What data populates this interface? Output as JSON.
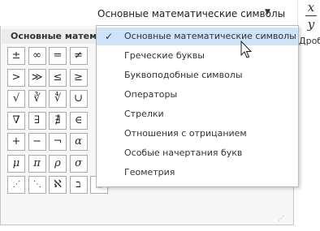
{
  "header": {
    "selected_category": "Основные математические символы",
    "dropdown_arrow": "▼"
  },
  "ribbon": {
    "fraction_top": "x",
    "fraction_bottom": "y",
    "fraction_label": "Дробь"
  },
  "gallery": {
    "title": "Основные математические символы",
    "rows": [
      [
        "±",
        "∞",
        "=",
        "≠"
      ],
      [
        ">",
        "≫",
        "≤",
        "≥"
      ],
      [
        "√",
        "∛",
        "∜",
        "∪"
      ],
      [
        "∇",
        "∃",
        "∄",
        "∈"
      ],
      [
        "+",
        "−",
        "¬",
        "α"
      ],
      [
        "μ",
        "π",
        "ρ",
        "σ"
      ],
      [
        "⋰",
        "⋱",
        "ℵ",
        "ב",
        "■"
      ]
    ],
    "grip": "⋰"
  },
  "menu": {
    "check_mark": "✓",
    "items": [
      {
        "label": "Основные математические символы",
        "selected": true
      },
      {
        "label": "Греческие буквы"
      },
      {
        "label": "Буквоподобные символы"
      },
      {
        "label": "Операторы"
      },
      {
        "label": "Стрелки"
      },
      {
        "label": "Отношения с отрицанием"
      },
      {
        "label": "Особые начертания букв"
      },
      {
        "label": "Геометрия"
      }
    ]
  },
  "colors": {
    "selected_item_bg": "#cde3f7",
    "panel_bg": "#f7f7f7"
  }
}
